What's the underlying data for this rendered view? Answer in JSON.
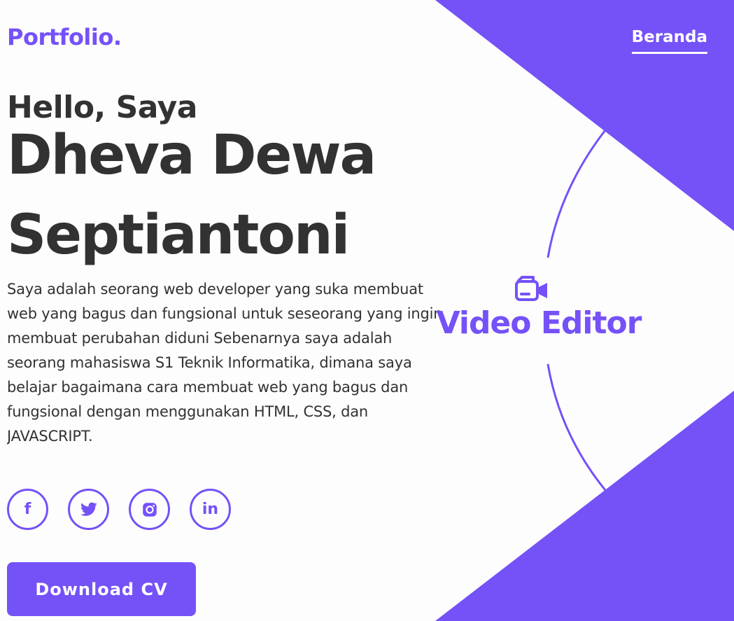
{
  "brand": {
    "logo": "Portfolio."
  },
  "nav": {
    "items": [
      {
        "label": "Beranda"
      }
    ]
  },
  "hero": {
    "greeting": "Hello, Saya",
    "name_line_1": "Dheva Dewa",
    "name_line_2": "Septiantoni",
    "about": "Saya adalah seorang web developer yang suka membuat web yang bagus dan fungsional untuk seseorang yang ingin membuat perubahan diduni Sebenarnya saya adalah seorang mahasiswa S1 Teknik Informatika, dimana saya belajar bagaimana cara membuat web yang bagus dan fungsional dengan menggunakan HTML, CSS, dan JAVASCRIPT."
  },
  "socials": [
    {
      "icon": "facebook-icon",
      "glyph": "f"
    },
    {
      "icon": "twitter-icon"
    },
    {
      "icon": "instagram-icon"
    },
    {
      "icon": "linkedin-icon",
      "glyph": "in"
    }
  ],
  "cta": {
    "download_label": "Download CV"
  },
  "role": {
    "icon": "video-camera-icon",
    "title": "Video Editor"
  },
  "colors": {
    "accent": "#7551f8",
    "text": "#323232",
    "background": "#fdfdfd",
    "on_accent": "#ffffff"
  }
}
